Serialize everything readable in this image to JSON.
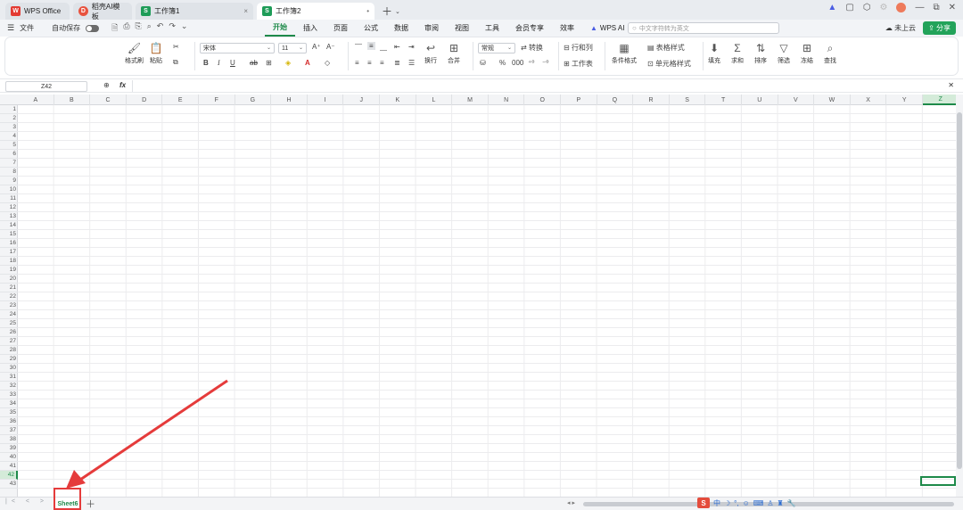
{
  "tabs": [
    {
      "label": "WPS Office",
      "icon": "wps-logo-icon"
    },
    {
      "label": "稻壳AI模板",
      "icon": "docer-icon"
    },
    {
      "label": "工作簿1",
      "icon": "spreadsheet-icon"
    },
    {
      "label": "工作簿2",
      "icon": "spreadsheet-icon"
    }
  ],
  "menubar": {
    "file": "文件",
    "autosave": "自动保存",
    "tabs": [
      "开始",
      "插入",
      "页面",
      "公式",
      "数据",
      "审阅",
      "视图",
      "工具",
      "会员专享",
      "效率"
    ],
    "active_tab": "开始",
    "wps_ai": "WPS AI",
    "search_placeholder": "中文字符转为英文",
    "cloud": "未上云",
    "share": "分享"
  },
  "ribbon": {
    "format_painter": "格式刷",
    "paste": "粘贴",
    "font_name": "宋体",
    "font_size": "11",
    "bold": "B",
    "italic": "I",
    "underline": "U",
    "wrap": "换行",
    "merge": "合并",
    "number_format": "常规",
    "convert": "转换",
    "row_col": "行和列",
    "worksheet": "工作表",
    "conditional_format": "条件格式",
    "table_style": "表格样式",
    "cell_style": "单元格样式",
    "fill": "填充",
    "sum": "求和",
    "sort": "排序",
    "filter": "筛选",
    "freeze": "冻结",
    "find": "查找"
  },
  "formula_bar": {
    "cell_ref": "Z42",
    "fx": "fx",
    "content": ""
  },
  "columns": [
    "A",
    "B",
    "C",
    "D",
    "E",
    "F",
    "G",
    "H",
    "I",
    "J",
    "K",
    "L",
    "M",
    "N",
    "O",
    "P",
    "Q",
    "R",
    "S",
    "T",
    "U",
    "V",
    "W",
    "X",
    "Y",
    "Z"
  ],
  "selected_column": "Z",
  "selected_row": 42,
  "row_count": 43,
  "sheet": {
    "name": "Sheet6"
  },
  "colors": {
    "accent": "#1e8a4a",
    "highlight": "#e53b3b"
  }
}
